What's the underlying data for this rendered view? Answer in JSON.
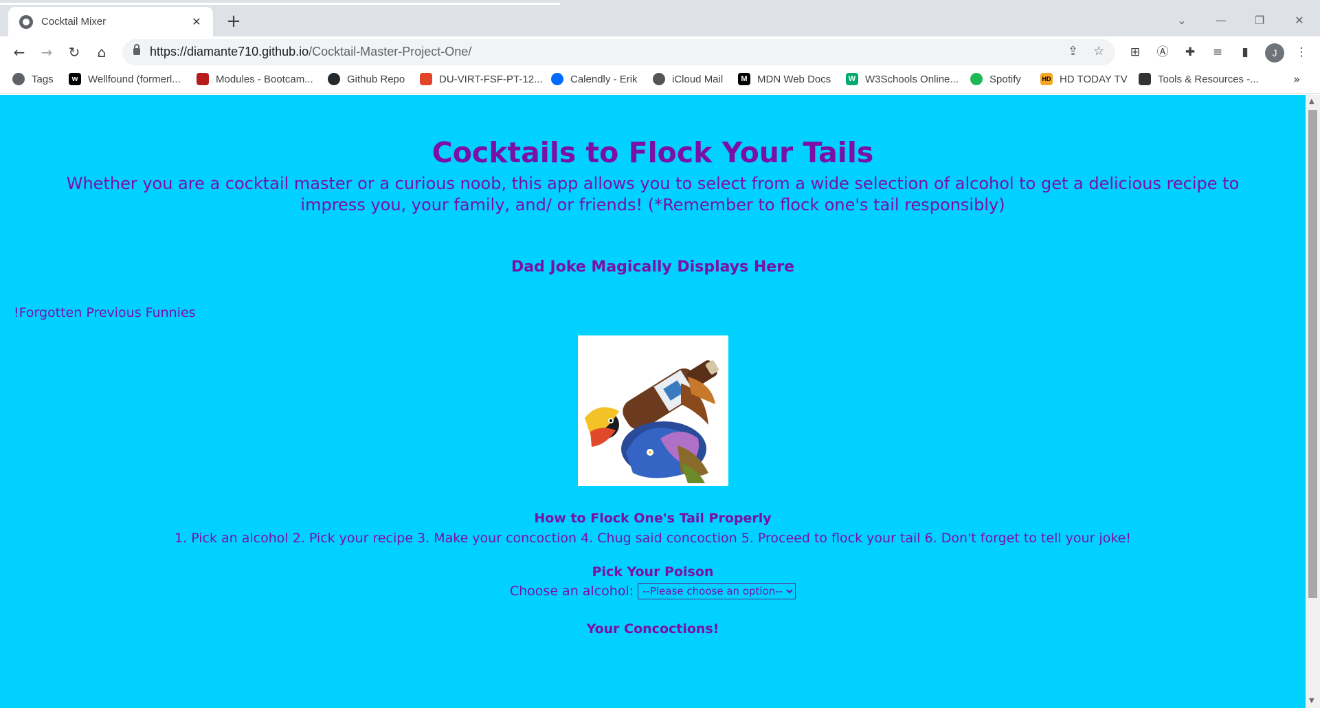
{
  "browser": {
    "tab_title": "Cocktail Mixer",
    "url_host": "https://diamante710.github.io",
    "url_path": "/Cocktail-Master-Project-One/",
    "profile_initial": "J",
    "bookmarks": [
      {
        "label": "Tags",
        "icon": "globe-icon",
        "color": "#5f6368"
      },
      {
        "label": "Wellfound (formerl...",
        "icon": "wellfound-icon",
        "color": "#000000"
      },
      {
        "label": "Modules - Bootcam...",
        "icon": "shield-icon",
        "color": "#b71c1c"
      },
      {
        "label": "Github Repo",
        "icon": "github-icon",
        "color": "#24292e"
      },
      {
        "label": "DU-VIRT-FSF-PT-12...",
        "icon": "gitlab-icon",
        "color": "#e24329"
      },
      {
        "label": "Calendly - Erik",
        "icon": "calendly-icon",
        "color": "#006bff"
      },
      {
        "label": "iCloud Mail",
        "icon": "apple-icon",
        "color": "#555555"
      },
      {
        "label": "MDN Web Docs",
        "icon": "mdn-icon",
        "color": "#000000"
      },
      {
        "label": "W3Schools Online...",
        "icon": "w3schools-icon",
        "color": "#04aa6d"
      },
      {
        "label": "Spotify",
        "icon": "spotify-icon",
        "color": "#1db954"
      },
      {
        "label": "HD TODAY TV",
        "icon": "hd-icon",
        "color": "#f5a623"
      },
      {
        "label": "Tools & Resources -...",
        "icon": "tools-icon",
        "color": "#333333"
      }
    ]
  },
  "page": {
    "title": "Cocktails to Flock Your Tails",
    "intro": "Whether you are a cocktail master or a curious noob, this app allows you to select from a wide selection of alcohol to get a delicious recipe to impress you, your family, and/ or friends! (*Remember to flock one's tail responsibly)",
    "joke": "Dad Joke Magically Displays Here",
    "previous_link": "!Forgotten Previous Funnies",
    "howto_title": "How to Flock One's Tail Properly",
    "howto_steps": "1. Pick an alcohol 2. Pick your recipe 3. Make your concoction 4. Chug said concoction 5. Proceed to flock your tail 6. Don't forget to tell your joke!",
    "pick_title": "Pick Your Poison",
    "pick_label": "Choose an alcohol:",
    "pick_selected": "--Please choose an option--",
    "concoctions_title": "Your Concoctions!"
  },
  "colors": {
    "page_background": "#00d1ff",
    "text_purple": "#7b10a5"
  }
}
